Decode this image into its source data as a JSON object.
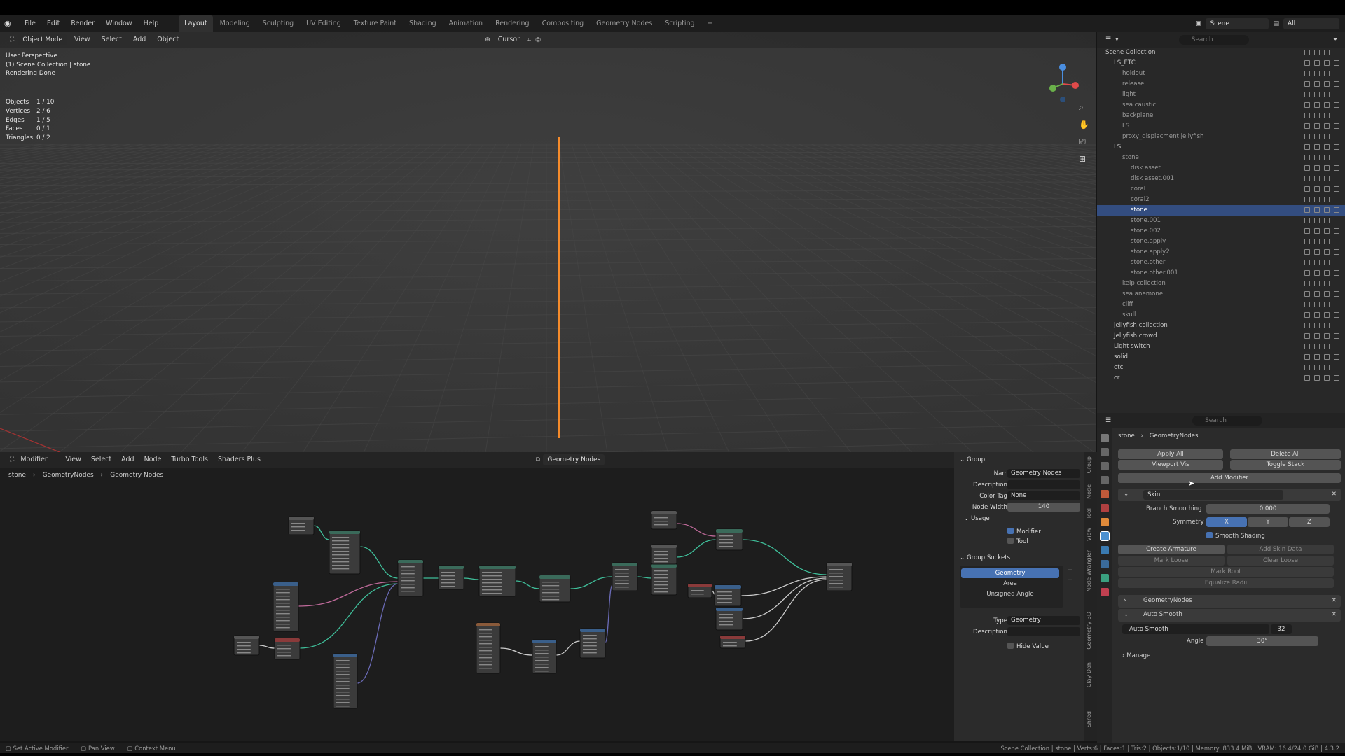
{
  "topbar": {
    "menus": [
      "File",
      "Edit",
      "Render",
      "Window",
      "Help"
    ],
    "workspaces": [
      "Layout",
      "Modeling",
      "Sculpting",
      "UV Editing",
      "Texture Paint",
      "Shading",
      "Animation",
      "Rendering",
      "Compositing",
      "Geometry Nodes",
      "Scripting"
    ],
    "active_workspace": "Layout",
    "scene": "Scene",
    "view_layer": "All"
  },
  "viewport": {
    "mode": "Object Mode",
    "menus": [
      "View",
      "Select",
      "Add",
      "Object"
    ],
    "transform": "Cursor",
    "info": [
      "User Perspective",
      "(1) Scene Collection | stone",
      "Rendering Done"
    ],
    "stats": [
      {
        "k": "Objects",
        "v": "1 / 10"
      },
      {
        "k": "Vertices",
        "v": "2 / 6"
      },
      {
        "k": "Edges",
        "v": "1 / 5"
      },
      {
        "k": "Faces",
        "v": "0 / 1"
      },
      {
        "k": "Triangles",
        "v": "0 / 2"
      }
    ]
  },
  "outliner": {
    "search_placeholder": "Search",
    "items": [
      {
        "name": "Scene Collection",
        "indent": 0,
        "sel": false
      },
      {
        "name": "LS_ETC",
        "indent": 1,
        "sel": false
      },
      {
        "name": "holdout",
        "indent": 2,
        "sel": false
      },
      {
        "name": "release",
        "indent": 2,
        "sel": false
      },
      {
        "name": "light",
        "indent": 2,
        "sel": false
      },
      {
        "name": "sea caustic",
        "indent": 2,
        "sel": false
      },
      {
        "name": "backplane",
        "indent": 2,
        "sel": false
      },
      {
        "name": "LS",
        "indent": 2,
        "sel": false
      },
      {
        "name": "proxy_displacment jellyfish",
        "indent": 2,
        "sel": false
      },
      {
        "name": "LS",
        "indent": 1,
        "sel": false
      },
      {
        "name": "stone",
        "indent": 2,
        "sel": false
      },
      {
        "name": "disk asset",
        "indent": 3,
        "sel": false
      },
      {
        "name": "disk asset.001",
        "indent": 3,
        "sel": false
      },
      {
        "name": "coral",
        "indent": 3,
        "sel": false
      },
      {
        "name": "coral2",
        "indent": 3,
        "sel": false
      },
      {
        "name": "stone",
        "indent": 3,
        "sel": true
      },
      {
        "name": "stone.001",
        "indent": 3,
        "sel": false
      },
      {
        "name": "stone.002",
        "indent": 3,
        "sel": false
      },
      {
        "name": "stone.apply",
        "indent": 3,
        "sel": false
      },
      {
        "name": "stone.apply2",
        "indent": 3,
        "sel": false
      },
      {
        "name": "stone.other",
        "indent": 3,
        "sel": false
      },
      {
        "name": "stone.other.001",
        "indent": 3,
        "sel": false
      },
      {
        "name": "kelp collection",
        "indent": 2,
        "sel": false
      },
      {
        "name": "sea anemone",
        "indent": 2,
        "sel": false
      },
      {
        "name": "cliff",
        "indent": 2,
        "sel": false
      },
      {
        "name": "skull",
        "indent": 2,
        "sel": false
      },
      {
        "name": "jellyfish collection",
        "indent": 1,
        "sel": false
      },
      {
        "name": "Jellyfish crowd",
        "indent": 1,
        "sel": false
      },
      {
        "name": "Light switch",
        "indent": 1,
        "sel": false
      },
      {
        "name": "solid",
        "indent": 1,
        "sel": false
      },
      {
        "name": "etc",
        "indent": 1,
        "sel": false
      },
      {
        "name": "cr",
        "indent": 1,
        "sel": false
      }
    ]
  },
  "properties": {
    "search_placeholder": "Search",
    "crumb_object": "stone",
    "crumb_modifier": "GeometryNodes",
    "apply_all": "Apply All",
    "delete_all": "Delete All",
    "viewport_vis": "Viewport Vis",
    "toggle_stack": "Toggle Stack",
    "add_modifier": "Add Modifier",
    "skin_name": "Skin",
    "branch_smoothing_label": "Branch Smoothing",
    "branch_smoothing_value": "0.000",
    "symmetry_label": "Symmetry",
    "sym_axes": [
      "X",
      "Y",
      "Z"
    ],
    "smooth_shading": "Smooth Shading",
    "create_armature": "Create Armature",
    "add_skin_data": "Add Skin Data",
    "mark_loose": "Mark Loose",
    "clear_loose": "Clear Loose",
    "mark_root": "Mark Root",
    "equalize_radii": "Equalize Radii",
    "geonodes_name": "GeometryNodes",
    "autosmooth_name": "Auto Smooth",
    "autosmooth_group": "Auto Smooth",
    "autosmooth_users": "32",
    "angle_label": "Angle",
    "angle_value": "30°",
    "manage": "Manage"
  },
  "node_editor": {
    "type": "Modifier",
    "menus": [
      "View",
      "Select",
      "Add",
      "Node",
      "Turbo Tools",
      "Shaders Plus"
    ],
    "tree_name": "Geometry Nodes",
    "crumbs": [
      "stone",
      "GeometryNodes",
      "Geometry Nodes"
    ]
  },
  "node_panel": {
    "group_title": "Group",
    "name_label": "Name",
    "name_value": "Geometry Nodes",
    "description_label": "Description",
    "color_tag_label": "Color Tag",
    "color_tag_value": "None",
    "node_width_label": "Node Width",
    "node_width_value": "140",
    "usage_title": "Usage",
    "usage_modifier": "Modifier",
    "usage_tool": "Tool",
    "sockets_title": "Group Sockets",
    "sockets": [
      "Geometry",
      "Area",
      "Unsigned Angle"
    ],
    "type_label": "Type",
    "type_value": "Geometry",
    "desc2_label": "Description",
    "hide_value": "Hide Value",
    "tabs": [
      "Group",
      "Node",
      "Tool",
      "View",
      "Node Wrangler",
      "Geometry 3D",
      "Clay Doh",
      "Shred"
    ]
  },
  "statusbar": {
    "left": [
      "Set Active Modifier",
      "Pan View",
      "Context Menu"
    ],
    "right": "Scene Collection | stone | Verts:6 | Faces:1 | Tris:2 | Objects:1/10 | Memory: 833.4 MiB | VRAM: 16.4/24.0 GiB | 4.3.2"
  },
  "colors": {
    "accent": "#4772b3",
    "selection": "#334d80",
    "origin_line": "#ff8f2a",
    "node_link": "#3fbf9a"
  }
}
